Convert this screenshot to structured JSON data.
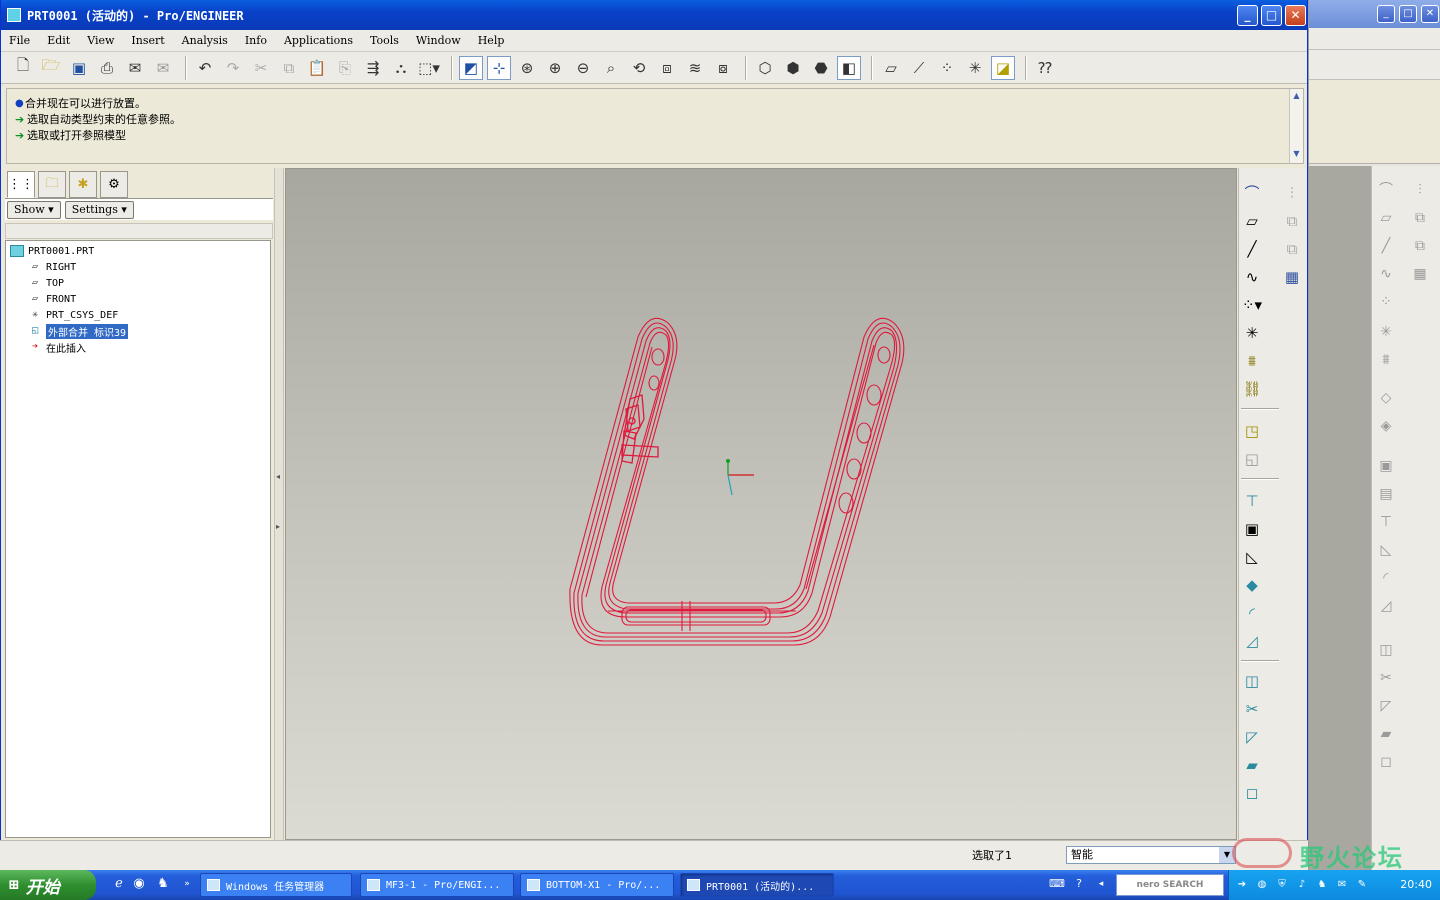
{
  "window": {
    "title": "PRT0001 (活动的) - Pro/ENGINEER",
    "minimize": "_",
    "maximize": "□",
    "close": "✕"
  },
  "menu": [
    "File",
    "Edit",
    "View",
    "Insert",
    "Analysis",
    "Info",
    "Applications",
    "Tools",
    "Window",
    "Help"
  ],
  "messages": [
    {
      "kind": "bullet",
      "text": "合并现在可以进行放置。"
    },
    {
      "kind": "prompt",
      "text": "选取自动类型约束的任意参照。"
    },
    {
      "kind": "prompt",
      "text": "选取或打开参照模型"
    }
  ],
  "navigator": {
    "show_label": "Show ▾",
    "settings_label": "Settings ▾",
    "tree": [
      {
        "label": "PRT0001.PRT",
        "icon": "part-icon",
        "level": 0
      },
      {
        "label": "RIGHT",
        "icon": "datum-plane-icon",
        "level": 1
      },
      {
        "label": "TOP",
        "icon": "datum-plane-icon",
        "level": 1
      },
      {
        "label": "FRONT",
        "icon": "datum-plane-icon",
        "level": 1
      },
      {
        "label": "PRT_CSYS_DEF",
        "icon": "csys-icon",
        "level": 1
      },
      {
        "label": "外部合并 标识39",
        "icon": "merge-feature-icon",
        "level": 1,
        "selected": true
      },
      {
        "label": "在此插入",
        "icon": "insert-here-arrow-icon",
        "level": 1
      }
    ]
  },
  "status": {
    "selected_count": "选取了1",
    "filter_value": "智能"
  },
  "taskbar": {
    "start_label": "开始",
    "tasks": [
      {
        "label": "Windows 任务管理器",
        "active": false
      },
      {
        "label": "MF3-1 - Pro/ENGI...",
        "active": false
      },
      {
        "label": "BOTTOM-X1 - Pro/...",
        "active": false
      },
      {
        "label": "PRT0001 (活动的)...",
        "active": true
      }
    ],
    "nero_label": "nero SEARCH",
    "clock": "20:40"
  },
  "watermark": {
    "text": "野火论坛"
  },
  "colors": {
    "title_bar": "#0a49d0",
    "model_wire": "#e0183c",
    "selection": "#316ac5"
  }
}
